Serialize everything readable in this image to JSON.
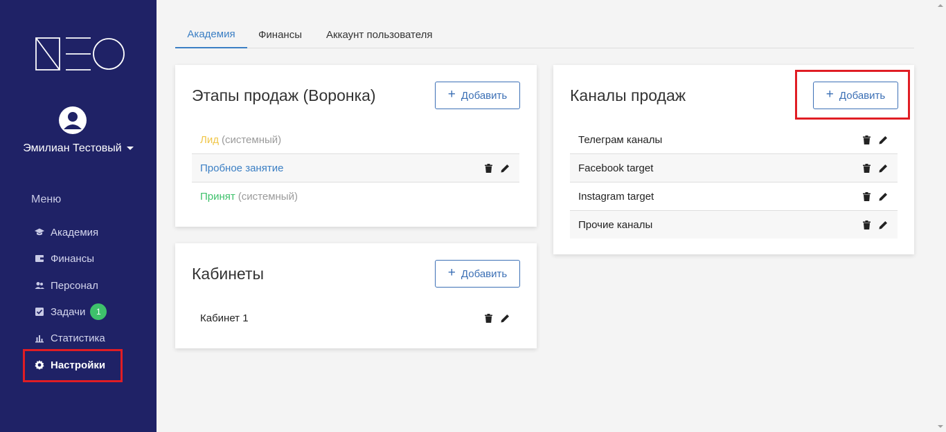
{
  "brand": {
    "logo_text": "NEO"
  },
  "user": {
    "name": "Эмилиан Тестовый"
  },
  "menu": {
    "heading": "Меню",
    "items": [
      {
        "label": "Академия",
        "icon": "graduation-cap-icon"
      },
      {
        "label": "Финансы",
        "icon": "wallet-icon"
      },
      {
        "label": "Персонал",
        "icon": "users-icon"
      },
      {
        "label": "Задачи",
        "icon": "check-square-icon",
        "badge": "1"
      },
      {
        "label": "Статистика",
        "icon": "bar-chart-icon"
      },
      {
        "label": "Настройки",
        "icon": "gear-icon",
        "active": true
      }
    ]
  },
  "tabs": [
    {
      "label": "Академия",
      "active": true
    },
    {
      "label": "Финансы"
    },
    {
      "label": "Аккаунт пользователя"
    }
  ],
  "sales_stages": {
    "title": "Этапы продаж (Воронка)",
    "add_label": "Добавить",
    "items": [
      {
        "name": "Лид",
        "note": "(системный)",
        "color": "#f0c649"
      },
      {
        "name": "Пробное занятие",
        "color": "#3b7fc4"
      },
      {
        "name": "Принят",
        "note": "(системный)",
        "color": "#3ec16b"
      }
    ]
  },
  "cabinets": {
    "title": "Кабинеты",
    "add_label": "Добавить",
    "items": [
      {
        "name": "Кабинет 1"
      }
    ]
  },
  "sales_channels": {
    "title": "Каналы продаж",
    "add_label": "Добавить",
    "items": [
      {
        "name": "Телеграм каналы"
      },
      {
        "name": "Facebook target"
      },
      {
        "name": "Instagram target"
      },
      {
        "name": "Прочие каналы"
      }
    ]
  },
  "colors": {
    "sidebar": "#1f2266",
    "accent": "#3b6fb5",
    "highlight": "#e01d24",
    "badge": "#3ec16b"
  }
}
